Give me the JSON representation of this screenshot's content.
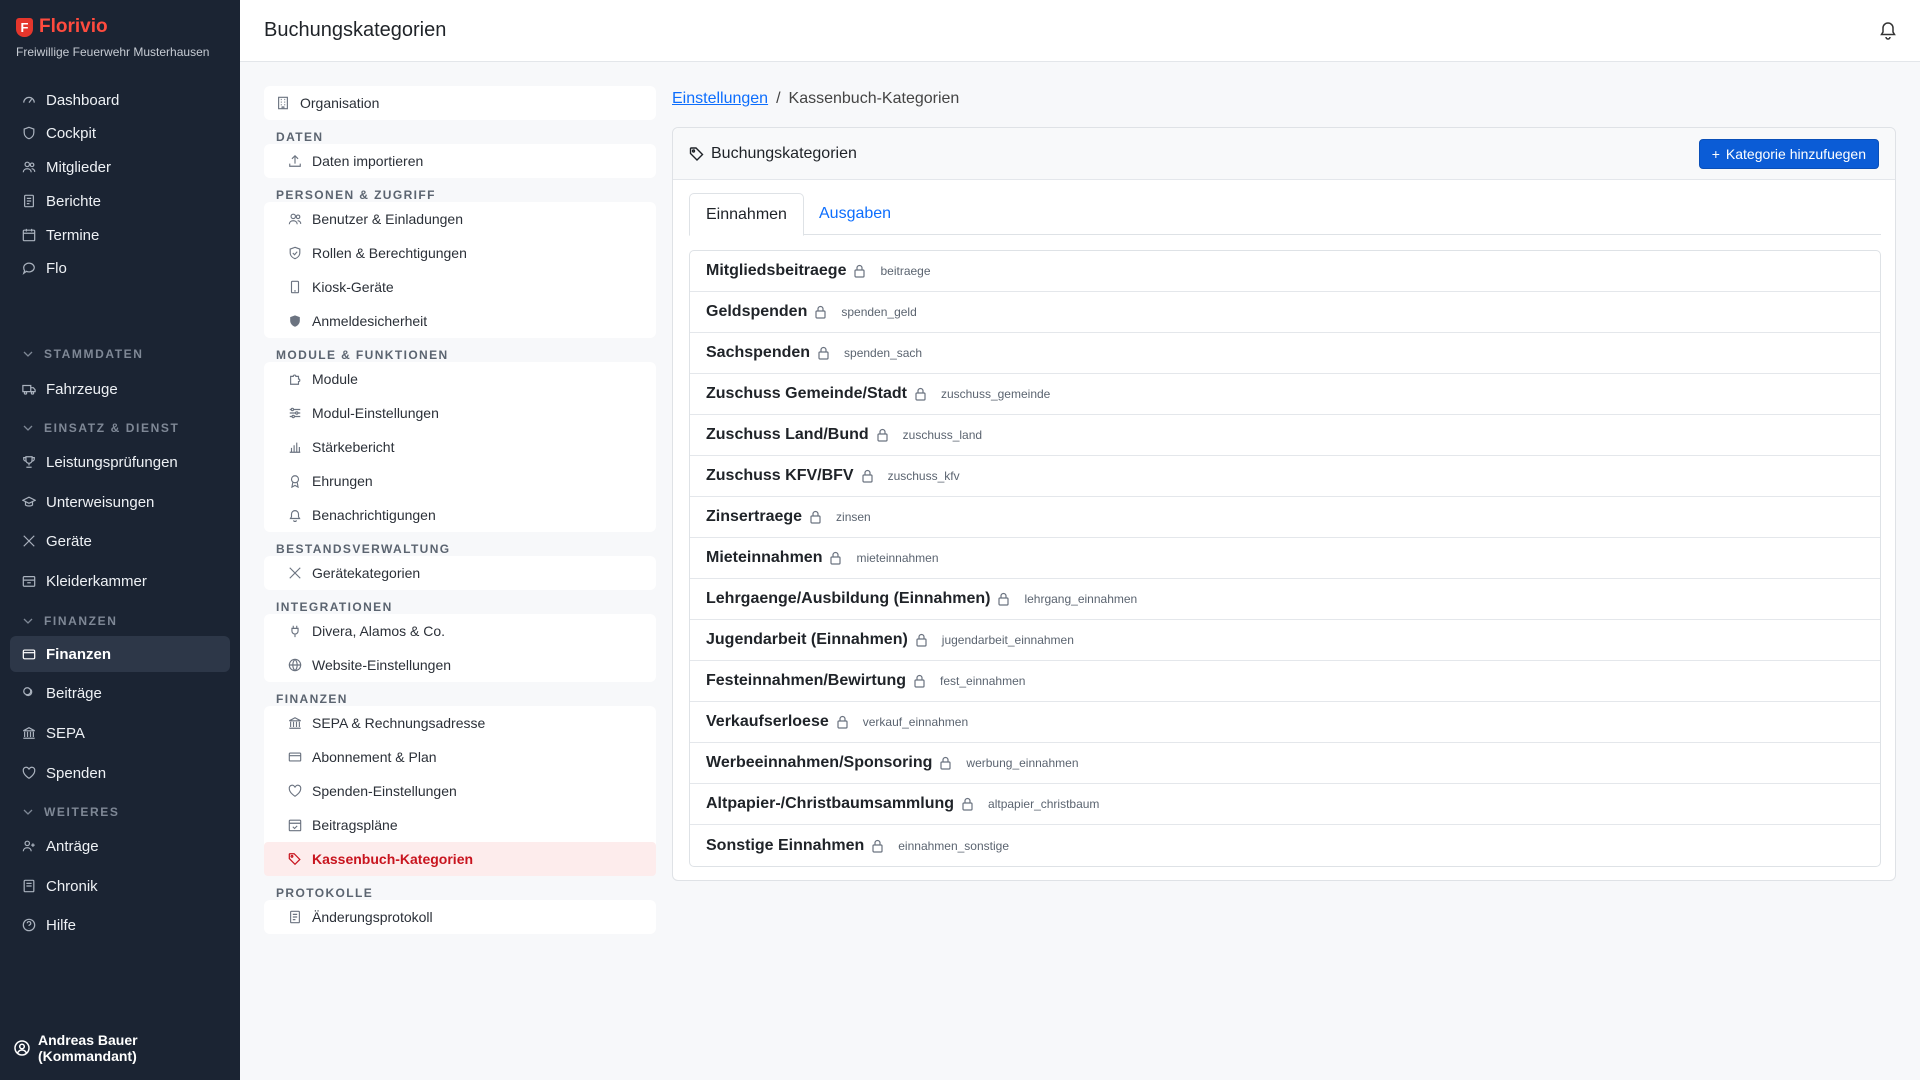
{
  "brand": {
    "name": "Florivio",
    "logo_letter": "F",
    "subtitle": "Freiwillige Feuerwehr Musterhausen"
  },
  "sidebar": {
    "items": [
      {
        "label": "Dashboard",
        "icon": "gauge-icon"
      },
      {
        "label": "Cockpit",
        "icon": "shield-icon"
      },
      {
        "label": "Mitglieder",
        "icon": "users-icon"
      },
      {
        "label": "Berichte",
        "icon": "document-icon"
      },
      {
        "label": "Termine",
        "icon": "calendar-icon"
      },
      {
        "label": "Flo",
        "icon": "chat-icon"
      }
    ],
    "sections": {
      "stammdaten": "STAMMDATEN",
      "einsatz": "EINSATZ & DIENST",
      "finanzen": "FINANZEN",
      "weiteres": "WEITERES"
    },
    "stammdaten_items": [
      {
        "label": "Fahrzeuge",
        "icon": "truck-icon"
      }
    ],
    "einsatz_items": [
      {
        "label": "Leistungsprüfungen",
        "icon": "trophy-icon"
      },
      {
        "label": "Unterweisungen",
        "icon": "graduation-icon"
      },
      {
        "label": "Geräte",
        "icon": "tools-icon"
      },
      {
        "label": "Kleiderkammer",
        "icon": "box-icon"
      }
    ],
    "finanzen_items": [
      {
        "label": "Finanzen",
        "icon": "wallet-icon",
        "active": true
      },
      {
        "label": "Beiträge",
        "icon": "coins-icon"
      },
      {
        "label": "SEPA",
        "icon": "bank-icon"
      },
      {
        "label": "Spenden",
        "icon": "heart-icon"
      }
    ],
    "weiteres_items": [
      {
        "label": "Anträge",
        "icon": "user-plus-icon"
      },
      {
        "label": "Chronik",
        "icon": "book-icon"
      },
      {
        "label": "Hilfe",
        "icon": "help-icon"
      }
    ],
    "user": "Andreas Bauer (Kommandant)"
  },
  "header": {
    "title": "Buchungskategorien"
  },
  "settings_nav": {
    "top": {
      "label": "Organisation"
    },
    "groups": [
      {
        "heading": "DATEN",
        "items": [
          "Daten importieren"
        ]
      },
      {
        "heading": "PERSONEN & ZUGRIFF",
        "items": [
          "Benutzer & Einladungen",
          "Rollen & Berechtigungen",
          "Kiosk-Geräte",
          "Anmeldesicherheit"
        ]
      },
      {
        "heading": "MODULE & FUNKTIONEN",
        "items": [
          "Module",
          "Modul-Einstellungen",
          "Stärkebericht",
          "Ehrungen",
          "Benachrichtigungen"
        ]
      },
      {
        "heading": "BESTANDSVERWALTUNG",
        "items": [
          "Gerätekategorien"
        ]
      },
      {
        "heading": "INTEGRATIONEN",
        "items": [
          "Divera, Alamos & Co.",
          "Website-Einstellungen"
        ]
      },
      {
        "heading": "FINANZEN",
        "items": [
          "SEPA & Rechnungsadresse",
          "Abonnement & Plan",
          "Spenden-Einstellungen",
          "Beitragspläne",
          "Kassenbuch-Kategorien"
        ]
      },
      {
        "heading": "PROTOKOLLE",
        "items": [
          "Änderungsprotokoll"
        ]
      }
    ],
    "active": "Kassenbuch-Kategorien"
  },
  "breadcrumb": {
    "link": "Einstellungen",
    "separator": "/",
    "current": "Kassenbuch-Kategorien"
  },
  "card": {
    "title": "Buchungskategorien",
    "add_button": "Kategorie hinzufuegen",
    "tabs": [
      "Einnahmen",
      "Ausgaben"
    ],
    "active_tab": "Einnahmen"
  },
  "categories": [
    {
      "name": "Mitgliedsbeitraege",
      "key": "beitraege"
    },
    {
      "name": "Geldspenden",
      "key": "spenden_geld"
    },
    {
      "name": "Sachspenden",
      "key": "spenden_sach"
    },
    {
      "name": "Zuschuss Gemeinde/Stadt",
      "key": "zuschuss_gemeinde"
    },
    {
      "name": "Zuschuss Land/Bund",
      "key": "zuschuss_land"
    },
    {
      "name": "Zuschuss KFV/BFV",
      "key": "zuschuss_kfv"
    },
    {
      "name": "Zinsertraege",
      "key": "zinsen"
    },
    {
      "name": "Mieteinnahmen",
      "key": "mieteinnahmen"
    },
    {
      "name": "Lehrgaenge/Ausbildung (Einnahmen)",
      "key": "lehrgang_einnahmen"
    },
    {
      "name": "Jugendarbeit (Einnahmen)",
      "key": "jugendarbeit_einnahmen"
    },
    {
      "name": "Festeinnahmen/Bewirtung",
      "key": "fest_einnahmen"
    },
    {
      "name": "Verkaufserloese",
      "key": "verkauf_einnahmen"
    },
    {
      "name": "Werbeeinnahmen/Sponsoring",
      "key": "werbung_einnahmen"
    },
    {
      "name": "Altpapier-/Christbaumsammlung",
      "key": "altpapier_christbaum"
    },
    {
      "name": "Sonstige Einnahmen",
      "key": "einnahmen_sonstige"
    }
  ]
}
